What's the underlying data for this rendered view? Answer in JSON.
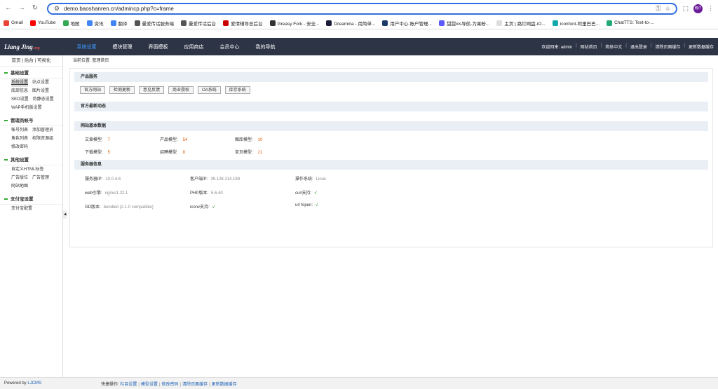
{
  "browser": {
    "url": "demo.baoshanren.cn/admincp.php?c=frame",
    "avatar": "用户"
  },
  "bookmarks": [
    "Gmail",
    "YouTube",
    "地图",
    "资讯",
    "翻译",
    "曼爱传话服务端",
    "曼爱传话后台",
    "爱情辅导总后台",
    "Greasy Fork - 安全...",
    "Dreamina - 用简单...",
    "用户中心-账户管理...",
    "甜甜ios导航-为果粉...",
    "主页 | 路灯网盘-iO...",
    "iconfont-阿里巴巴...",
    "ChatTTS: Text-to-..."
  ],
  "bookmark_colors": [
    "#ea4335",
    "#ff0000",
    "#34a853",
    "#4285f4",
    "#4285f4",
    "#555",
    "#555",
    "#c00",
    "#333",
    "#1a1a3a",
    "#1a3a6a",
    "#5a5aff",
    "#ddd",
    "#1aa",
    "#2a7"
  ],
  "logo": {
    "main": "Liang Jing",
    "suffix": ".org"
  },
  "nav": [
    "系统设置",
    "模块管理",
    "界面模板",
    "应用商店",
    "会员中心",
    "我的导航"
  ],
  "toplinks": {
    "welcome": "欢迎回来: admin",
    "items": [
      "网站首页",
      "简体中文",
      "退出登录",
      "清除页面缓存",
      "更新数据缓存"
    ]
  },
  "sidebar": {
    "head": "首页 | 后台 | 可视化",
    "groups": [
      {
        "title": "基础设置",
        "rows": [
          [
            "系统设置",
            "站点设置"
          ],
          [
            "底部信息",
            "图片设置"
          ],
          [
            "SEO设置",
            "伪静态设置"
          ],
          [
            "WAP手机版设置"
          ]
        ]
      },
      {
        "title": "管理员帐号",
        "rows": [
          [
            "帐号列表",
            "添加管理员"
          ],
          [
            "角色列表",
            "权限资源组"
          ],
          [
            "修改密码"
          ]
        ]
      },
      {
        "title": "其他设置",
        "rows": [
          [
            "自定义HTML标签"
          ],
          [
            "广告版位",
            "广告管理"
          ],
          [
            "网站地图"
          ]
        ]
      },
      {
        "title": "支付宝设置",
        "rows": [
          [
            "支付宝配置"
          ]
        ]
      }
    ]
  },
  "crumb": {
    "label": "当前位置:",
    "value": "管理首页"
  },
  "sections": {
    "product": {
      "title": "产品服务",
      "buttons": [
        "官方网站",
        "检测更新",
        "意见反馈",
        "商业授权",
        "OA系统",
        "库存系统"
      ]
    },
    "news": {
      "title": "官方最新动态"
    },
    "basic": {
      "title": "网站基本数据",
      "items": [
        [
          "文章模型:",
          "7"
        ],
        [
          "产品模型:",
          "54"
        ],
        [
          "图库模型:",
          "10"
        ],
        [
          "下载模型:",
          "5"
        ],
        [
          "招聘模型:",
          "8"
        ],
        [
          "单页模型:",
          "21"
        ]
      ]
    },
    "server": {
      "title": "服务器信息",
      "items": [
        [
          "服务器IP:",
          "10.0.4.6"
        ],
        [
          "客户端IP:",
          "39.128.214.189"
        ],
        [
          "操作系统:",
          "Linux"
        ],
        [
          "web引擎:",
          "nginx/1.22.1"
        ],
        [
          "PHP版本:",
          "5.6.40"
        ],
        [
          "curl支持:",
          "√"
        ],
        [
          "GD版本:",
          "bundled (2.1.0 compatible)"
        ],
        [
          "iconv支持:",
          "√"
        ],
        [
          "url fopen:",
          "√"
        ]
      ]
    }
  },
  "footer": {
    "powered": "Powered by",
    "brand": "LJCMS",
    "label": "快捷操作:",
    "links": [
      "栏目设置",
      "模型设置",
      "修改密码",
      "清除页面缓存",
      "更新数据缓存"
    ]
  }
}
